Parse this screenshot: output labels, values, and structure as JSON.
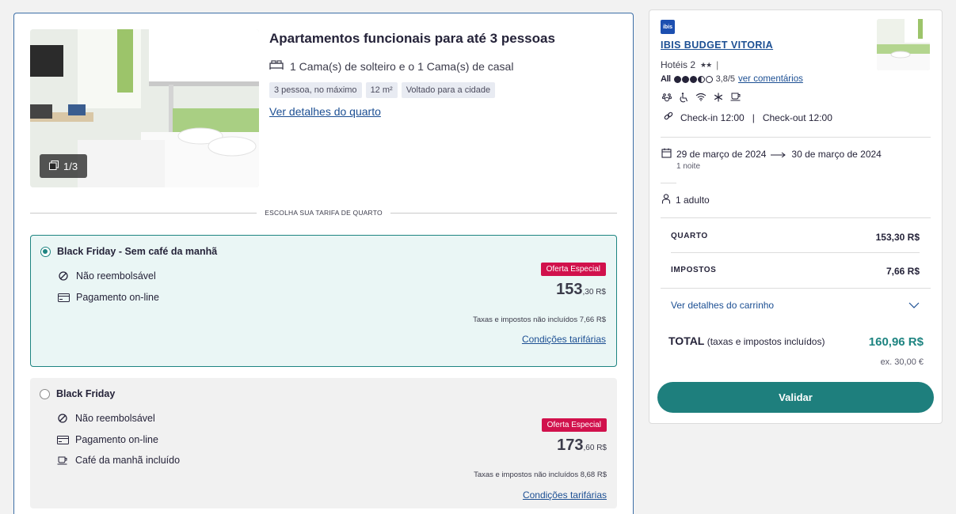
{
  "room": {
    "title": "Apartamentos funcionais para até 3 pessoas",
    "photo_counter": "1/3",
    "bed_info": "1 Cama(s) de solteiro e o 1 Cama(s) de casal",
    "tags": [
      "3 pessoa, no máximo",
      "12 m²",
      "Voltado para a cidade"
    ],
    "details_link": "Ver detalhes do quarto"
  },
  "rate_divider": "ESCOLHA SUA TARIFA DE QUARTO",
  "rates": [
    {
      "name": "Black Friday - Sem café da manhã",
      "selected": true,
      "conditions": [
        {
          "icon": "no-refund-icon",
          "text": "Não reembolsável"
        },
        {
          "icon": "card-icon",
          "text": "Pagamento on-line"
        }
      ],
      "badge": "Oferta Especial",
      "price_int": "153",
      "price_dec": ",30 R$",
      "taxes": "Taxas e impostos não incluídos 7,66 R$",
      "conditions_link": "Condições tarifárias"
    },
    {
      "name": "Black Friday",
      "selected": false,
      "conditions": [
        {
          "icon": "no-refund-icon",
          "text": "Não reembolsável"
        },
        {
          "icon": "card-icon",
          "text": "Pagamento on-line"
        },
        {
          "icon": "coffee-icon",
          "text": "Café da manhã incluído"
        }
      ],
      "badge": "Oferta Especial",
      "price_int": "173",
      "price_dec": ",60 R$",
      "taxes": "Taxas e impostos não incluídos 8,68 R$",
      "conditions_link": "Condições tarifárias"
    }
  ],
  "summary": {
    "logo_text": "ibis",
    "hotel_name": "IBIS BUDGET VITORIA",
    "category": "Hotéis 2",
    "stars": "★★",
    "rating_brand": "All",
    "rating_value": "3,8/5",
    "rating_level": 3.8,
    "reviews_link": "ver comentários",
    "amenity_icons": [
      "pet-icon",
      "accessibility-icon",
      "wifi-icon",
      "air-conditioning-icon",
      "breakfast-icon"
    ],
    "checkin": "Check-in 12:00",
    "checkout": "Check-out 12:00",
    "date_from": "29 de março de 2024",
    "date_to": "30 de março de 2024",
    "nights": "1 noite",
    "guests": "1 adulto",
    "room_label": "QUARTO",
    "room_price": "153,30 R$",
    "tax_label": "IMPOSTOS",
    "tax_price": "7,66 R$",
    "cart_link": "Ver detalhes do carrinho",
    "total_label": "TOTAL",
    "total_note": "(taxas e impostos incluídos)",
    "total_price": "160,96 R$",
    "total_eur": "ex. 30,00 €",
    "validate_label": "Validar"
  },
  "colors": {
    "accent_teal": "#1e8481",
    "link_blue": "#1c4f93",
    "badge_red": "#d1114c",
    "selected_bg": "#eaf6f5"
  }
}
